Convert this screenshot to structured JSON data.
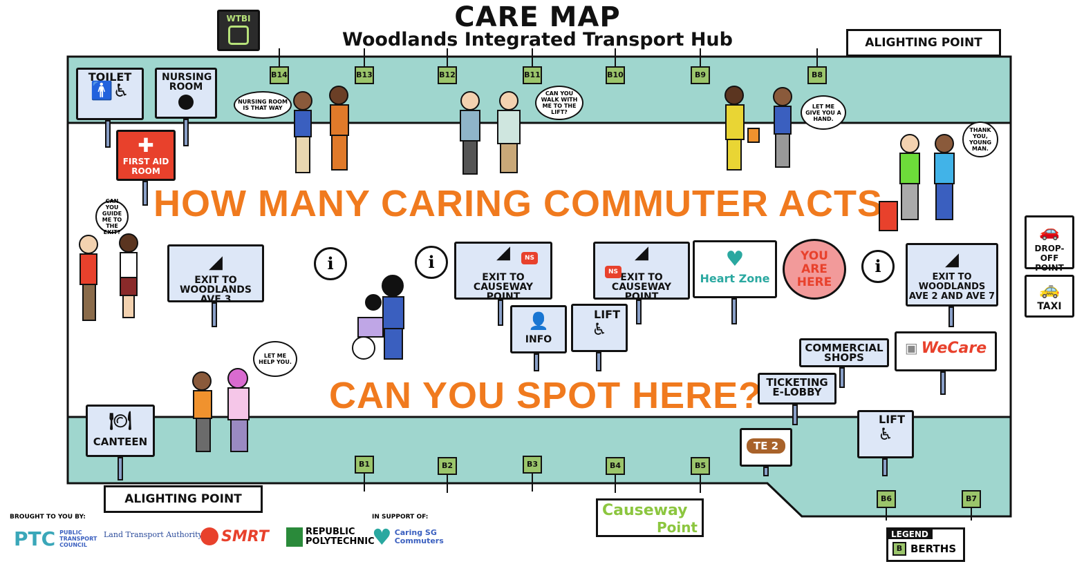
{
  "header": {
    "title": "CARE MAP",
    "subtitle": "Woodlands Integrated Transport Hub"
  },
  "headline": {
    "line1": "HOW MANY CARING COMMUTER ACTS",
    "line2": "CAN YOU SPOT HERE?"
  },
  "bus_stop_sign": "WTBI",
  "alighting_top": "ALIGHTING POINT",
  "alighting_bottom": "ALIGHTING POINT",
  "berths_top": [
    "B14",
    "B13",
    "B12",
    "B11",
    "B10",
    "B9",
    "B8"
  ],
  "berths_bottom": [
    "B1",
    "B2",
    "B3",
    "B4",
    "B5",
    "B6",
    "B7"
  ],
  "signs": {
    "toilet": "TOILET",
    "nursing": "NURSING ROOM",
    "first_aid": "FIRST AID ROOM",
    "exit_ave3": "EXIT TO WOODLANDS AVE 3",
    "exit_causeway_1": "EXIT TO CAUSEWAY POINT",
    "exit_causeway_2": "EXIT TO CAUSEWAY POINT",
    "ns_badge": "NS",
    "heart_zone": "Heart Zone",
    "you_are_here": "YOU ARE HERE",
    "exit_ave2": "EXIT TO WOODLANDS AVE 2 AND AVE 7",
    "info": "INFO",
    "lift": "LIFT",
    "lift2": "LIFT",
    "commercial": "COMMERCIAL SHOPS",
    "ticketing": "TICKETING E-LOBBY",
    "wecare": "WeCare",
    "canteen": "CANTEEN",
    "te2": "TE 2",
    "drop_off": "DROP-OFF POINT",
    "taxi": "TAXI",
    "info_icon": "i"
  },
  "bubbles": {
    "nursing_help": "NURSING ROOM IS THAT WAY",
    "walk_lift": "CAN YOU WALK WITH ME TO THE LIFT?",
    "give_hand": "LET ME GIVE YOU A HAND.",
    "thank_you": "THANK YOU, YOUNG MAN.",
    "guide_exit": "CAN YOU GUIDE ME TO THE EXIT?",
    "help_you": "LET ME HELP YOU."
  },
  "causeway": {
    "word1": "Causeway",
    "word2": "Point"
  },
  "legend": {
    "title": "LEGEND",
    "badge": "B",
    "label": "BERTHS"
  },
  "footer": {
    "brought": "BROUGHT TO YOU BY:",
    "support": "IN SUPPORT OF:",
    "ptc": "PTC",
    "ptc_name": "PUBLIC TRANSPORT COUNCIL",
    "lta": "Land Transport Authority",
    "smrt": "SMRT",
    "rp": "REPUBLIC POLYTECHNIC",
    "caring": "Caring SG Commuters"
  },
  "colors": {
    "orange": "#f07a1e",
    "teal": "#9fd6ce",
    "sign": "#dde7f7",
    "berth": "#9bc56b",
    "red": "#e8412c",
    "pink": "#f29a9a"
  }
}
